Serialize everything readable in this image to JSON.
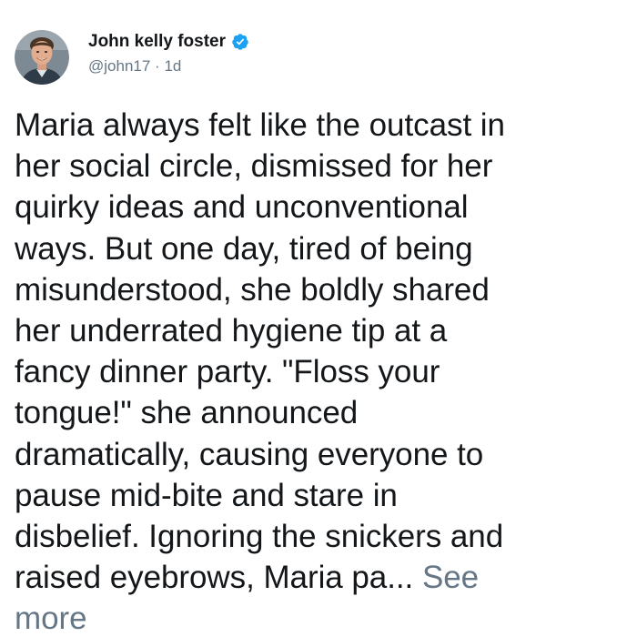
{
  "tweet": {
    "author": {
      "display_name": "John kelly foster",
      "handle": "@john17",
      "verified": true,
      "avatar_icon": "profile-photo"
    },
    "meta_separator": "·",
    "timestamp": "1d",
    "body_lines": [
      "Maria always felt like the outcast in",
      "her social circle, dismissed for her",
      "quirky ideas and unconventional",
      "ways. But one day, tired of being",
      "misunderstood, she boldly shared",
      "her underrated hygiene tip at a",
      "fancy dinner party. \"Floss your",
      "tongue!\" she announced",
      "dramatically, causing everyone to",
      "pause mid-bite and stare in",
      "disbelief. Ignoring the snickers and",
      "raised eyebrows, Maria pa..."
    ],
    "see_more_label": "See\nmore"
  },
  "colors": {
    "text": "#14171a",
    "secondary_text": "#657786",
    "verified_badge": "#1da1f2"
  }
}
